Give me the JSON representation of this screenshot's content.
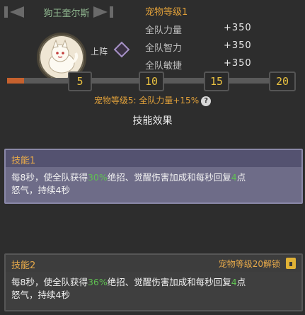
{
  "header": {
    "pet_name": "狗王奎尔斯",
    "level_title": "宠物等级1",
    "stats": [
      {
        "label": "全队力量",
        "value": "+350"
      },
      {
        "label": "全队智力",
        "value": "+350"
      },
      {
        "label": "全队敏捷",
        "value": "+350"
      }
    ],
    "deploy_label": "上阵"
  },
  "progress": {
    "fraction": 0.06,
    "milestones": [
      "5",
      "10",
      "15",
      "20"
    ]
  },
  "level_bonus": "宠物等级5: 全队力量+15%",
  "section_title": "技能效果",
  "skills": [
    {
      "title": "技能1",
      "desc_a": "每8秒，使全队获得",
      "desc_pct": "30%",
      "desc_b": "绝招、觉醒伤害加成和每秒回复",
      "desc_num": "4",
      "desc_c": "点",
      "desc_line2": "怒气，持续4秒"
    },
    {
      "title": "技能2",
      "unlock": "宠物等级20解锁",
      "desc_a": "每8秒，使全队获得",
      "desc_pct": "36%",
      "desc_b": "绝招、觉醒伤害加成和每秒回复",
      "desc_num": "4",
      "desc_c": "点",
      "desc_line2": "怒气，持续4秒"
    }
  ],
  "colors": {
    "accent_orange": "#e0a03a",
    "highlight_green": "#5fbf52",
    "milestone_yellow": "#e8c040",
    "progress_fill": "#c6612e"
  },
  "icons": [
    "prev-arrow-icon",
    "next-arrow-icon",
    "pet-avatar-icon",
    "deploy-diamond-icon",
    "help-icon",
    "lock-icon"
  ]
}
